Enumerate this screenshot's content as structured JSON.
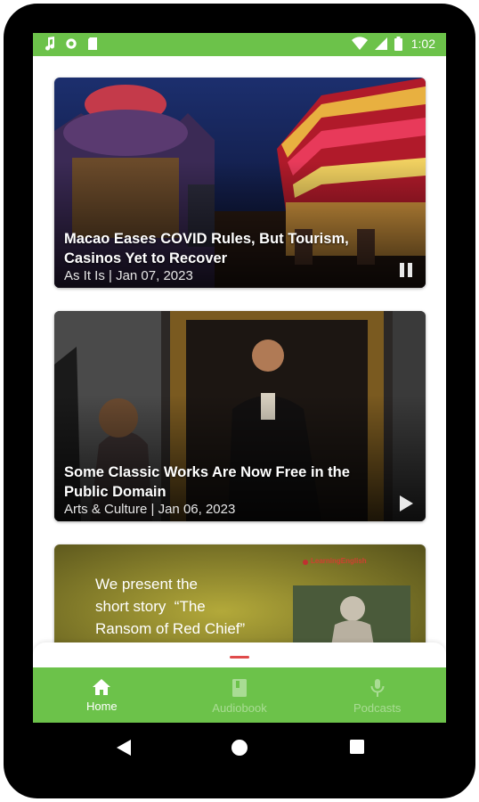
{
  "status_bar": {
    "time": "1:02",
    "left_icons": [
      "music-note-icon",
      "circle-icon",
      "sd-card-icon"
    ],
    "right_icons": [
      "wifi-icon",
      "signal-icon",
      "battery-icon"
    ]
  },
  "articles": [
    {
      "title": "Macao Eases COVID Rules, But Tourism, Casinos Yet to Recover",
      "meta": "As It Is | Jan 07, 2023",
      "control": "pause-icon"
    },
    {
      "title": "Some Classic Works Are Now Free in the Public Domain",
      "meta": "Arts & Culture | Jan 06, 2023",
      "control": "play-icon"
    },
    {
      "line1": "We present the",
      "line2": "short story  “The",
      "line3": "Ransom of Red Chief”",
      "badge": "LearningEnglish"
    }
  ],
  "bottom_nav": {
    "items": [
      {
        "label": "Home",
        "icon": "home-icon",
        "active": true
      },
      {
        "label": "Audiobook",
        "icon": "book-icon",
        "active": false
      },
      {
        "label": "Podcasts",
        "icon": "microphone-icon",
        "active": false
      }
    ]
  },
  "colors": {
    "accent": "#6cc24a",
    "inactive_nav": "#a9dc94",
    "handle": "#e04b4b"
  }
}
